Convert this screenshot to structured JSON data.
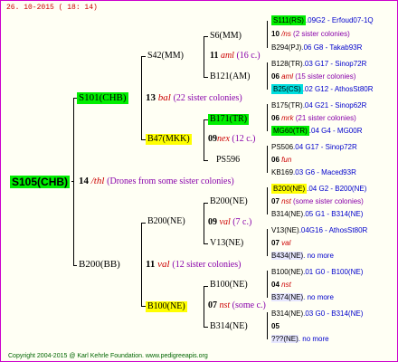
{
  "header": "26. 10-2015 ( 18: 14)",
  "footer": "Copyright 2004-2015 @ Karl Kehrle Foundation.   www.pedigreeapis.org",
  "root": {
    "id": "S105(CHB)",
    "num": "14",
    "name": "/thl",
    "note": "(Drones from some sister colonies)"
  },
  "gen2": [
    {
      "id": "S101(CHB)",
      "num": "13",
      "name": "bal",
      "note": "(22 sister colonies)"
    },
    {
      "id": "B200(BB)",
      "num": "11",
      "name": "val",
      "note": "(12 sister colonies)"
    }
  ],
  "gen3": [
    {
      "id": "S42(MM)"
    },
    {
      "id": "B47(MKK)",
      "num": "09",
      "name": "nex",
      "note": "(12 c.)"
    },
    {
      "id": "B200(NE)",
      "num": "09",
      "name": "val",
      "note": "(7 c.)"
    },
    {
      "id": "B100(NE)",
      "num": "07",
      "name": "nst",
      "note": "(some c.)"
    }
  ],
  "gen4": [
    {
      "id": "S6(MM)",
      "num": "11",
      "name": "aml",
      "note": "(16 c.)"
    },
    {
      "id": "B121(AM)"
    },
    {
      "id": "B171(TR)",
      "num": "06",
      "name": "mrk",
      "note": "(21 sister colonies)"
    },
    {
      "id": "PS596",
      "num": "06",
      "name": "fun"
    },
    {
      "id": "B200(NE)",
      "num": "07",
      "name": "nst",
      "note": "(some sister colonies)"
    },
    {
      "id": "V13(NE)",
      "num": "07",
      "name": "val"
    },
    {
      "id": "B100(NE)",
      "num": "04",
      "name": "nst"
    },
    {
      "id": "B314(NE)",
      "num": "05"
    }
  ],
  "gen5": [
    {
      "id": "S111(RS)",
      "rest": ".09G2 - Erfoud07-1Q"
    },
    {
      "id": "10",
      "extra": "/ns",
      "note": "(2 sister colonies)"
    },
    {
      "id": "B294(PJ)",
      "rest": ".06      G8 - Takab93R"
    },
    {
      "id": "B128(TR)",
      "rest": ".03   G17 - Sinop72R"
    },
    {
      "id": "06",
      "extra": "aml",
      "note": "(15 sister colonies)"
    },
    {
      "id": "B25(CS)",
      "rest": ".02   G12 - AthosSt80R"
    },
    {
      "id": "B175(TR)",
      "rest": ".04  G21 - Sinop62R"
    },
    {
      "id": "06",
      "extra": "mrk",
      "note": "(21 sister colonies)"
    },
    {
      "id": "MG60(TR)",
      "rest": ".04      G4 - MG00R"
    },
    {
      "id": "PS506",
      "rest": ".04          G17 - Sinop72R"
    },
    {
      "id": "06",
      "extra": "fun"
    },
    {
      "id": "KB169",
      "rest": ".03        G6 - Maced93R"
    },
    {
      "id": "B200(NE)",
      "rest": ".04     G2 - B200(NE)"
    },
    {
      "id": "07",
      "extra": "nst",
      "note": "(some sister colonies)"
    },
    {
      "id": "B314(NE)",
      "rest": ".05     G1 - B314(NE)"
    },
    {
      "id": "V13(NE)",
      "rest": ".04G16 - AthosSt80R"
    },
    {
      "id": "07",
      "extra": "val"
    },
    {
      "id": "B434(NE)",
      "rest": ".            no more"
    },
    {
      "id": "B100(NE)",
      "rest": ".01     G0 - B100(NE)"
    },
    {
      "id": "04",
      "extra": "nst"
    },
    {
      "id": "B374(NE)",
      "rest": ".            no more"
    },
    {
      "id": "B314(NE)",
      "rest": ".03     G0 - B314(NE)"
    },
    {
      "id": "05"
    },
    {
      "id": "???(NE)",
      "rest": ".            no more"
    }
  ]
}
